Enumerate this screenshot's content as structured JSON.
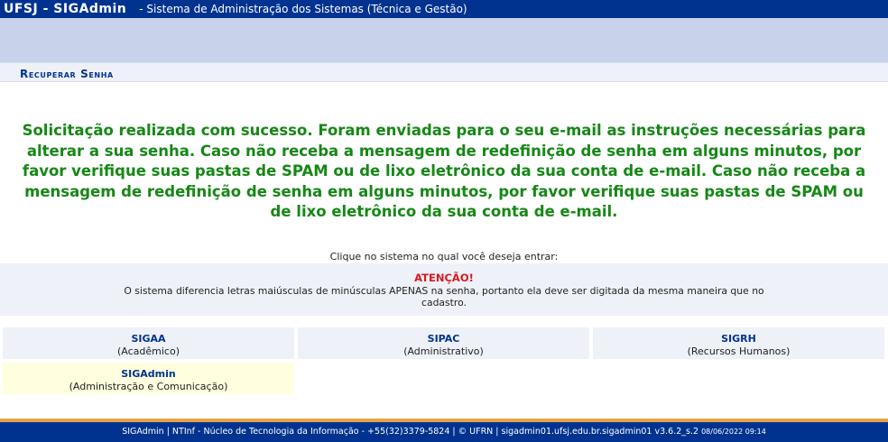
{
  "header": {
    "brand": "UFSJ - SIGAdmin",
    "subtitle": "- Sistema de Administração dos Sistemas (Técnica e Gestão)"
  },
  "section": {
    "title": "Recuperar Senha"
  },
  "message": {
    "success": "Solicitação realizada com sucesso. Foram enviadas para o seu e-mail as instruções necessárias para alterar a sua senha. Caso não receba a mensagem de redefinição de senha em alguns minutos, por favor verifique suas pastas de SPAM ou de lixo eletrônico da sua conta de e-mail. Caso não receba a mensagem de redefinição de senha em alguns minutos, por favor verifique suas pastas de SPAM ou de lixo eletrônico da sua conta de e-mail."
  },
  "prompt": "Clique no sistema no qual você deseja entrar:",
  "attention": {
    "title": "ATENÇÃO!",
    "text": "O sistema diferencia letras maiúsculas de minúsculas APENAS na senha, portanto ela deve ser digitada da mesma maneira que no cadastro."
  },
  "systems": [
    {
      "name": "SIGAA",
      "desc": "(Acadêmico)"
    },
    {
      "name": "SIPAC",
      "desc": "(Administrativo)"
    },
    {
      "name": "SIGRH",
      "desc": "(Recursos Humanos)"
    },
    {
      "name": "SIGAdmin",
      "desc": "(Administração e Comunicação)"
    }
  ],
  "footer": {
    "text": "SIGAdmin | NTInf - Núcleo de Tecnologia da Informação - +55(32)3379-5824 | © UFRN | sigadmin01.ufsj.edu.br.sigadmin01 v3.6.2_s.2",
    "timestamp": "08/06/2022 09:14"
  },
  "colors": {
    "header": "#003390",
    "banner": "#c8d3eb",
    "success": "#168716",
    "attention": "#d81b1b",
    "footer_accent": "#e8a246"
  }
}
